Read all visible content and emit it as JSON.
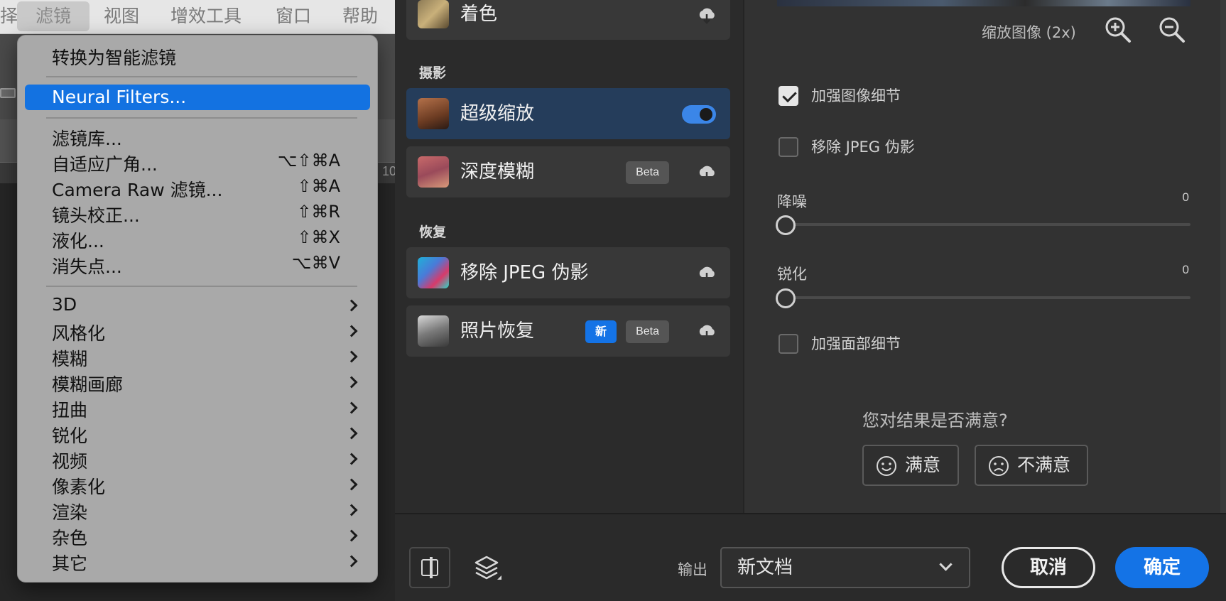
{
  "menubar": {
    "items": [
      "择",
      "滤镜",
      "视图",
      "增效工具",
      "窗口",
      "帮助"
    ]
  },
  "ruler": {
    "tick": "10"
  },
  "filter_menu": {
    "convert_smart": "转换为智能滤镜",
    "neural_filters": "Neural Filters...",
    "items": [
      {
        "label": "滤镜库...",
        "shortcut": ""
      },
      {
        "label": "自适应广角...",
        "shortcut": "⌥⇧⌘A"
      },
      {
        "label": "Camera Raw 滤镜...",
        "shortcut": "⇧⌘A"
      },
      {
        "label": "镜头校正...",
        "shortcut": "⇧⌘R"
      },
      {
        "label": "液化...",
        "shortcut": "⇧⌘X"
      },
      {
        "label": "消失点...",
        "shortcut": "⌥⌘V"
      }
    ],
    "submenus": [
      "3D",
      "风格化",
      "模糊",
      "模糊画廊",
      "扭曲",
      "锐化",
      "视频",
      "像素化",
      "渲染",
      "杂色",
      "其它"
    ]
  },
  "filters_list": {
    "top_item": "着色",
    "section_photo": "摄影",
    "section_restore": "恢复",
    "cards": {
      "super_zoom": {
        "title": "超级缩放"
      },
      "depth_blur": {
        "title": "深度模糊",
        "badge": "Beta"
      },
      "jpeg_removal": {
        "title": "移除 JPEG 伪影"
      },
      "photo_restore": {
        "title": "照片恢复",
        "badge_new": "新",
        "badge_beta": "Beta"
      }
    }
  },
  "settings": {
    "scale_label": "缩放图像 (2x)",
    "enhance_detail": "加强图像细节",
    "remove_jpeg": "移除 JPEG 伪影",
    "noise_label": "降噪",
    "noise_value": "0",
    "sharpen_label": "锐化",
    "sharpen_value": "0",
    "face_detail": "加强面部细节",
    "satisfaction_q": "您对结果是否满意?",
    "satisfied": "满意",
    "unsatisfied": "不满意"
  },
  "bottom": {
    "output_label": "输出",
    "output_value": "新文档",
    "cancel": "取消",
    "ok": "确定"
  }
}
